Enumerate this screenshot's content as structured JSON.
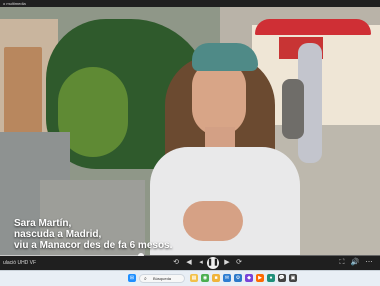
{
  "window": {
    "title": "o multimedia"
  },
  "video": {
    "subtitle": "Sara Martín,\nnascuda a Madrid,\nviu a Manacor des de fa 6 mesos.",
    "progress": 0.37
  },
  "controls": {
    "title_label": "ulació UHD VF",
    "rewind_icon": "rewind-icon",
    "previous_icon": "previous-icon",
    "play_pause_icon": "play-pause-icon",
    "next_icon": "next-icon",
    "fullscreen_icon": "fullscreen-icon",
    "volume_icon": "volume-icon",
    "settings_icon": "settings-icon"
  },
  "taskbar": {
    "search_placeholder": "Búsqueda",
    "icons": [
      {
        "name": "windows-icon",
        "color": "#1f8fff",
        "glyph": "⊞"
      },
      {
        "name": "file-explorer-icon",
        "color": "#f2c14a",
        "glyph": "▦"
      },
      {
        "name": "chrome-icon",
        "color": "#4caf50",
        "glyph": "◉"
      },
      {
        "name": "folder-icon",
        "color": "#f0b43a",
        "glyph": "■"
      },
      {
        "name": "mail-icon",
        "color": "#2d7dd2",
        "glyph": "✉"
      },
      {
        "name": "settings-icon",
        "color": "#2c78c9",
        "glyph": "⚙"
      },
      {
        "name": "app-icon",
        "color": "#7a43d8",
        "glyph": "◆"
      },
      {
        "name": "media-icon",
        "color": "#ff6a00",
        "glyph": "▶"
      },
      {
        "name": "camera-icon",
        "color": "#1f8f7a",
        "glyph": "●"
      }
    ]
  }
}
